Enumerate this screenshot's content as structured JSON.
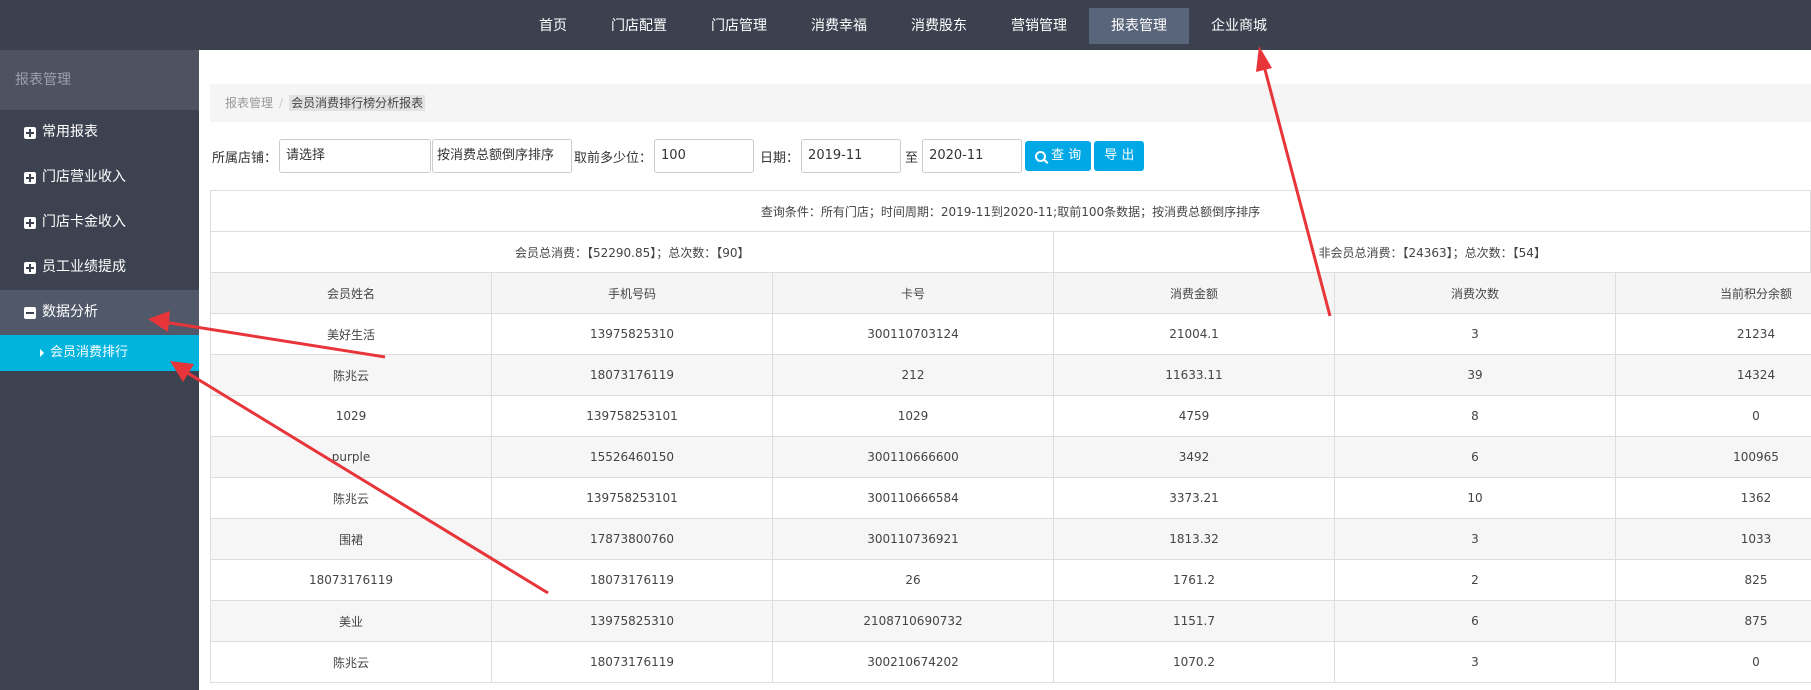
{
  "topnav": [
    "首页",
    "门店配置",
    "门店管理",
    "消费幸福",
    "消费股东",
    "营销管理",
    "报表管理",
    "企业商城"
  ],
  "sidebar": {
    "title": "报表管理",
    "items": [
      "常用报表",
      "门店营业收入",
      "门店卡金收入",
      "员工业绩提成",
      "数据分析"
    ],
    "sub_item": "会员消费排行"
  },
  "breadcrumb": {
    "root": "报表管理",
    "separator": "/",
    "current": "会员消费排行榜分析报表"
  },
  "filters": {
    "store_label": "所属店铺：",
    "store_value": "请选择",
    "sort_value": "按消费总额倒序排序",
    "top_label": "取前多少位：",
    "top_value": "100",
    "date_label": "日期：",
    "date_from": "2019-11",
    "date_to_label": "至",
    "date_to": "2020-11",
    "query_button": "查 询",
    "export_button": "导 出"
  },
  "report": {
    "condition": "查询条件：所有门店；时间周期：2019-11到2020-11;取前100条数据；按消费总额倒序排序",
    "member_summary": "会员总消费：【52290.85】；总次数：【90】",
    "nonmember_summary": "非会员总消费：【24363】；总次数：【54】",
    "columns": [
      "会员姓名",
      "手机号码",
      "卡号",
      "消费金额",
      "消费次数",
      "当前积分余额"
    ],
    "rows": [
      [
        "美好生活",
        "13975825310",
        "300110703124",
        "21004.1",
        "3",
        "21234"
      ],
      [
        "陈兆云",
        "18073176119",
        "212",
        "11633.11",
        "39",
        "14324"
      ],
      [
        "1029",
        "139758253101",
        "1029",
        "4759",
        "8",
        "0"
      ],
      [
        "purple",
        "15526460150",
        "300110666600",
        "3492",
        "6",
        "100965"
      ],
      [
        "陈兆云",
        "139758253101",
        "300110666584",
        "3373.21",
        "10",
        "1362"
      ],
      [
        "围裙",
        "17873800760",
        "300110736921",
        "1813.32",
        "3",
        "1033"
      ],
      [
        "18073176119",
        "18073176119",
        "26",
        "1761.2",
        "2",
        "825"
      ],
      [
        "美业",
        "13975825310",
        "2108710690732",
        "1151.7",
        "6",
        "875"
      ],
      [
        "陈兆云",
        "18073176119",
        "300210674202",
        "1070.2",
        "3",
        "0"
      ]
    ]
  },
  "colors": {
    "topbar": "#3b414f",
    "sidebar": "#3d4251",
    "accent": "#00b4de",
    "button": "#00a8e6",
    "arrow": "#e8353a"
  }
}
